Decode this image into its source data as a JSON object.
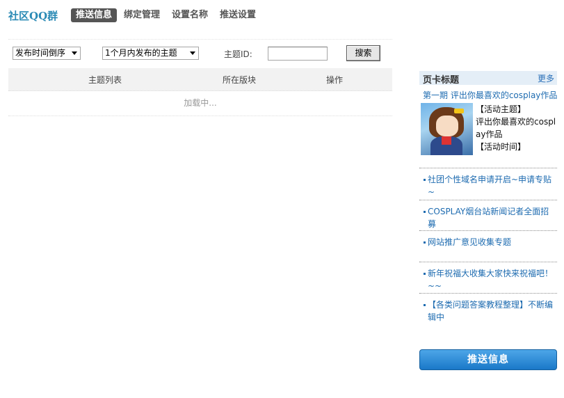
{
  "header": {
    "brand": "社区QQ群",
    "nav": [
      {
        "label": "推送信息",
        "active": true
      },
      {
        "label": "绑定管理",
        "active": false
      },
      {
        "label": "设置名称",
        "active": false
      },
      {
        "label": "推送设置",
        "active": false
      }
    ]
  },
  "filters": {
    "order_select": "发布时间倒序",
    "range_select": "1个月内发布的主题",
    "topic_label": "主题ID:",
    "topic_input_value": "",
    "search_label": "搜索"
  },
  "table": {
    "columns": [
      "主题列表",
      "所在版块",
      "操作"
    ],
    "loading_text": "加载中..."
  },
  "sidebar": {
    "title": "页卡标题",
    "more": "更多",
    "feature": {
      "title": "第一期  评出你最喜欢的cosplay作品",
      "lines": [
        "【活动主题】",
        "评出你最喜欢的cosplay作品",
        "【活动时间】"
      ]
    },
    "news": [
      "社团个性域名申请开启~申请专贴~",
      "COSPLAY烟台站新闻记者全面招募",
      "网站推广意见收集专题",
      "新年祝福大收集大家快来祝福吧！~~",
      "【各类问题答案教程整理】不断编辑中"
    ],
    "push_button": "推送信息"
  },
  "colors": {
    "brand": "#2a8ab5",
    "link": "#1d6bb0",
    "nav_active_bg": "#555555",
    "push_button": "#1a78c8"
  }
}
